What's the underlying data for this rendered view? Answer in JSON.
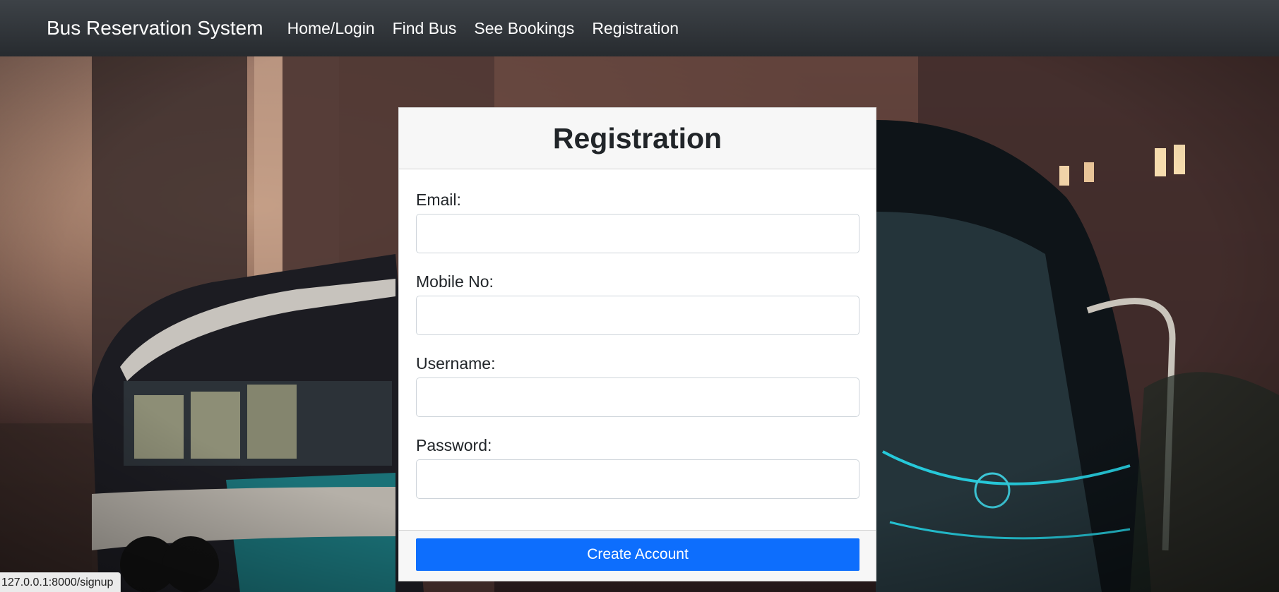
{
  "navbar": {
    "brand": "Bus Reservation System",
    "links": [
      "Home/Login",
      "Find Bus",
      "See Bookings",
      "Registration"
    ]
  },
  "form": {
    "title": "Registration",
    "fields": [
      {
        "label": "Email:",
        "value": "",
        "placeholder": ""
      },
      {
        "label": "Mobile No:",
        "value": "",
        "placeholder": ""
      },
      {
        "label": "Username:",
        "value": "",
        "placeholder": ""
      },
      {
        "label": "Password:",
        "value": "",
        "placeholder": ""
      }
    ],
    "submit_label": "Create Account"
  },
  "status_bar": {
    "url": "127.0.0.1:8000/signup"
  },
  "colors": {
    "navbar": "#2f3438",
    "primary_button": "#0d6efd",
    "card_header": "#f7f7f7"
  },
  "background": {
    "description_icon": "bus-photo-background"
  }
}
